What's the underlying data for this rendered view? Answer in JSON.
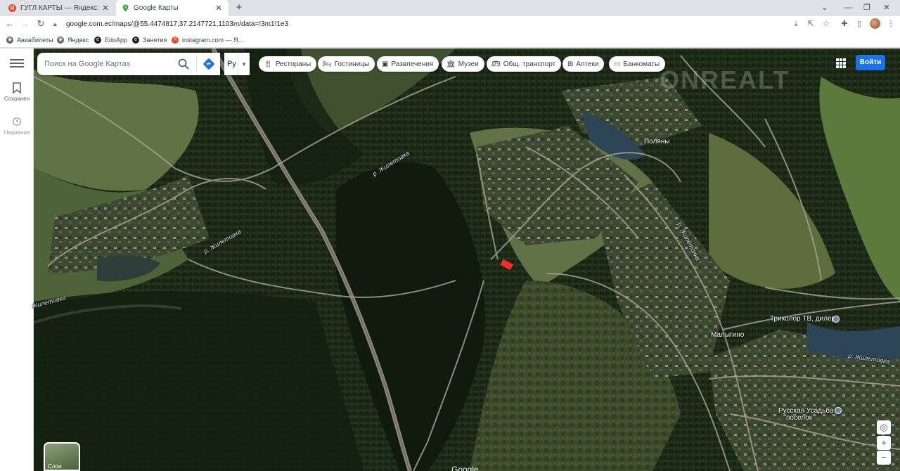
{
  "browser": {
    "tabs": [
      {
        "title": "ГУГЛ КАРТЫ — Яндекс: нашлось",
        "active": false
      },
      {
        "title": "Google Карты",
        "active": true
      }
    ],
    "url": "google.com.ec/maps/@55.4474817,37.2147721,1103m/data=!3m1!1e3",
    "bookmarks": [
      "Авиабилеты",
      "Яндекс",
      "EduApp",
      "Занятия",
      "instagram.com — Я..."
    ]
  },
  "maps": {
    "search_placeholder": "Поиск на Google Картах",
    "lang": "Ру",
    "sidebar": [
      {
        "label": "Сохранен"
      },
      {
        "label": "Недавние"
      }
    ],
    "chips": [
      {
        "label": "Рестораны",
        "icon": "fork-knife-icon"
      },
      {
        "label": "Гостиницы",
        "icon": "bed-icon"
      },
      {
        "label": "Развлечения",
        "icon": "ticket-icon"
      },
      {
        "label": "Музеи",
        "icon": "museum-icon"
      },
      {
        "label": "Общ. транспорт",
        "icon": "bus-icon"
      },
      {
        "label": "Аптеки",
        "icon": "pharmacy-icon"
      },
      {
        "label": "Банкоматы",
        "icon": "atm-icon"
      }
    ],
    "signin_label": "Войти",
    "layers_label": "Слои",
    "watermark": "Google"
  },
  "map_labels": {
    "polyany": "Поляны",
    "malygino": "Малыгино",
    "tricolor": "Триколор ТВ, дилер",
    "usadba": "Русская Усадьба",
    "poselok": "поселок",
    "river_1": "р. Жилетовка",
    "river_2": "р. Жилетовка",
    "river_3": "Жилетовка",
    "river_4": "р. Жилетовка",
    "river_5": "р. Жилетовка"
  },
  "overlay_watermark": "ONREALT"
}
